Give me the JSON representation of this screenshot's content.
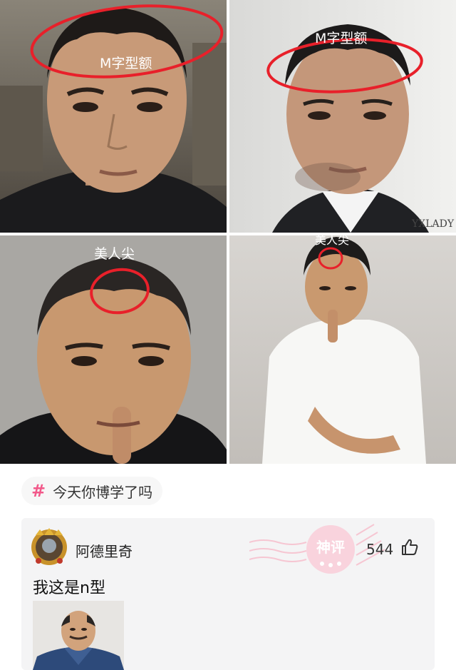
{
  "panels": {
    "top_left": {
      "annotation": "M字型额"
    },
    "top_right": {
      "annotation": "M字型额",
      "watermark": "YXLADY"
    },
    "bottom_left": {
      "annotation": "美人尖"
    },
    "bottom_right": {
      "annotation": "美人尖"
    }
  },
  "topic_tag": {
    "icon": "hash-icon",
    "symbol": "#",
    "text": "今天你博学了吗"
  },
  "comment": {
    "username": "阿德里奇",
    "likes": "544",
    "badge": "神评",
    "text": "我这是n型"
  },
  "colors": {
    "accent_pink": "#f2598a",
    "circle_red": "#e8202a"
  }
}
